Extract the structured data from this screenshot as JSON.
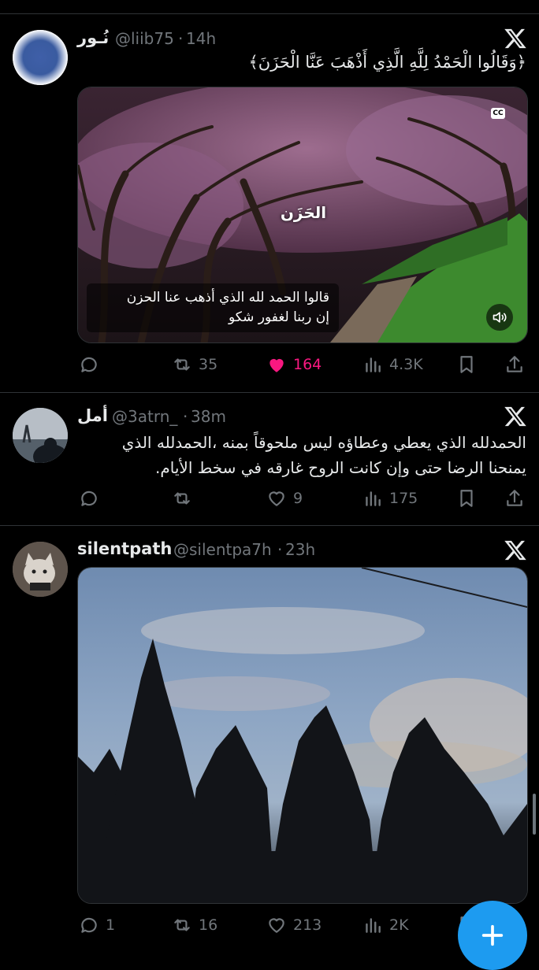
{
  "posts": [
    {
      "display_name": "نُـور",
      "handle": "@liib75",
      "time": "14h",
      "text_lines": [
        "﴿وَقَالُوا الْحَمْدُ لِلَّهِ الَّذِي أَذْهَبَ عَنَّا الْحَزَنَ﴾"
      ],
      "media": {
        "type": "video",
        "title_overlay": "الحَزَن",
        "cc_label": "CC",
        "caption_lines": [
          "قالوا الحمد لله الذي أذهب عنا الحزن",
          "إن ربنا لغفور شكو"
        ]
      },
      "replies": "",
      "reposts": "35",
      "likes": "164",
      "liked": true,
      "views": "4.3K"
    },
    {
      "display_name": "أمل",
      "handle": "@3atrn_",
      "time": "38m",
      "text_lines": [
        "الحمدلله الذي يعطي وعطاؤه ليس ملحوقاً بمنه ،الحمدلله الذي",
        "يمنحنا الرضا حتى وإن كانت الروح غارقه في سخط الأيام."
      ],
      "replies": "",
      "reposts": "",
      "likes": "9",
      "liked": false,
      "views": "175"
    },
    {
      "display_name": "silentpath",
      "handle": "@silentpa7h",
      "time": "23h",
      "text_lines": [],
      "media": {
        "type": "photo"
      },
      "replies": "1",
      "reposts": "16",
      "likes": "213",
      "liked": false,
      "views": "2K"
    }
  ],
  "colors": {
    "background": "#000000",
    "text": "#e7e9ea",
    "muted": "#71767b",
    "like_active": "#f91880",
    "accent": "#1d9bf0",
    "divider": "#2f3336"
  },
  "icons": {
    "reply": "speech-bubble-icon",
    "repost": "repost-arrows-icon",
    "like": "heart-icon",
    "views": "bar-chart-icon",
    "bookmark": "bookmark-icon",
    "share": "share-icon",
    "platform": "x-logo-icon",
    "compose": "plus-icon"
  }
}
